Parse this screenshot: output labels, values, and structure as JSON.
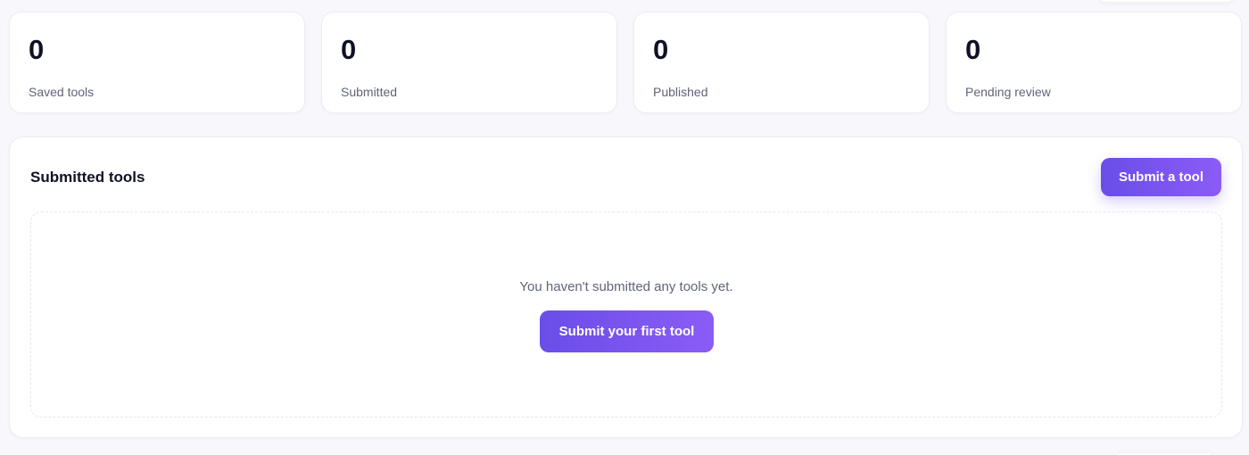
{
  "stats": [
    {
      "value": "0",
      "label": "Saved tools"
    },
    {
      "value": "0",
      "label": "Submitted"
    },
    {
      "value": "0",
      "label": "Published"
    },
    {
      "value": "0",
      "label": "Pending review"
    }
  ],
  "submitted_panel": {
    "title": "Submitted tools",
    "submit_button_label": "Submit a tool",
    "empty_message": "You haven't submitted any tools yet.",
    "first_tool_button_label": "Submit your first tool"
  },
  "colors": {
    "accent_start": "#6a4de8",
    "accent_end": "#8b5cf6",
    "background": "#f8f8fc",
    "text_primary": "#0f1226",
    "text_secondary": "#5f6478"
  }
}
